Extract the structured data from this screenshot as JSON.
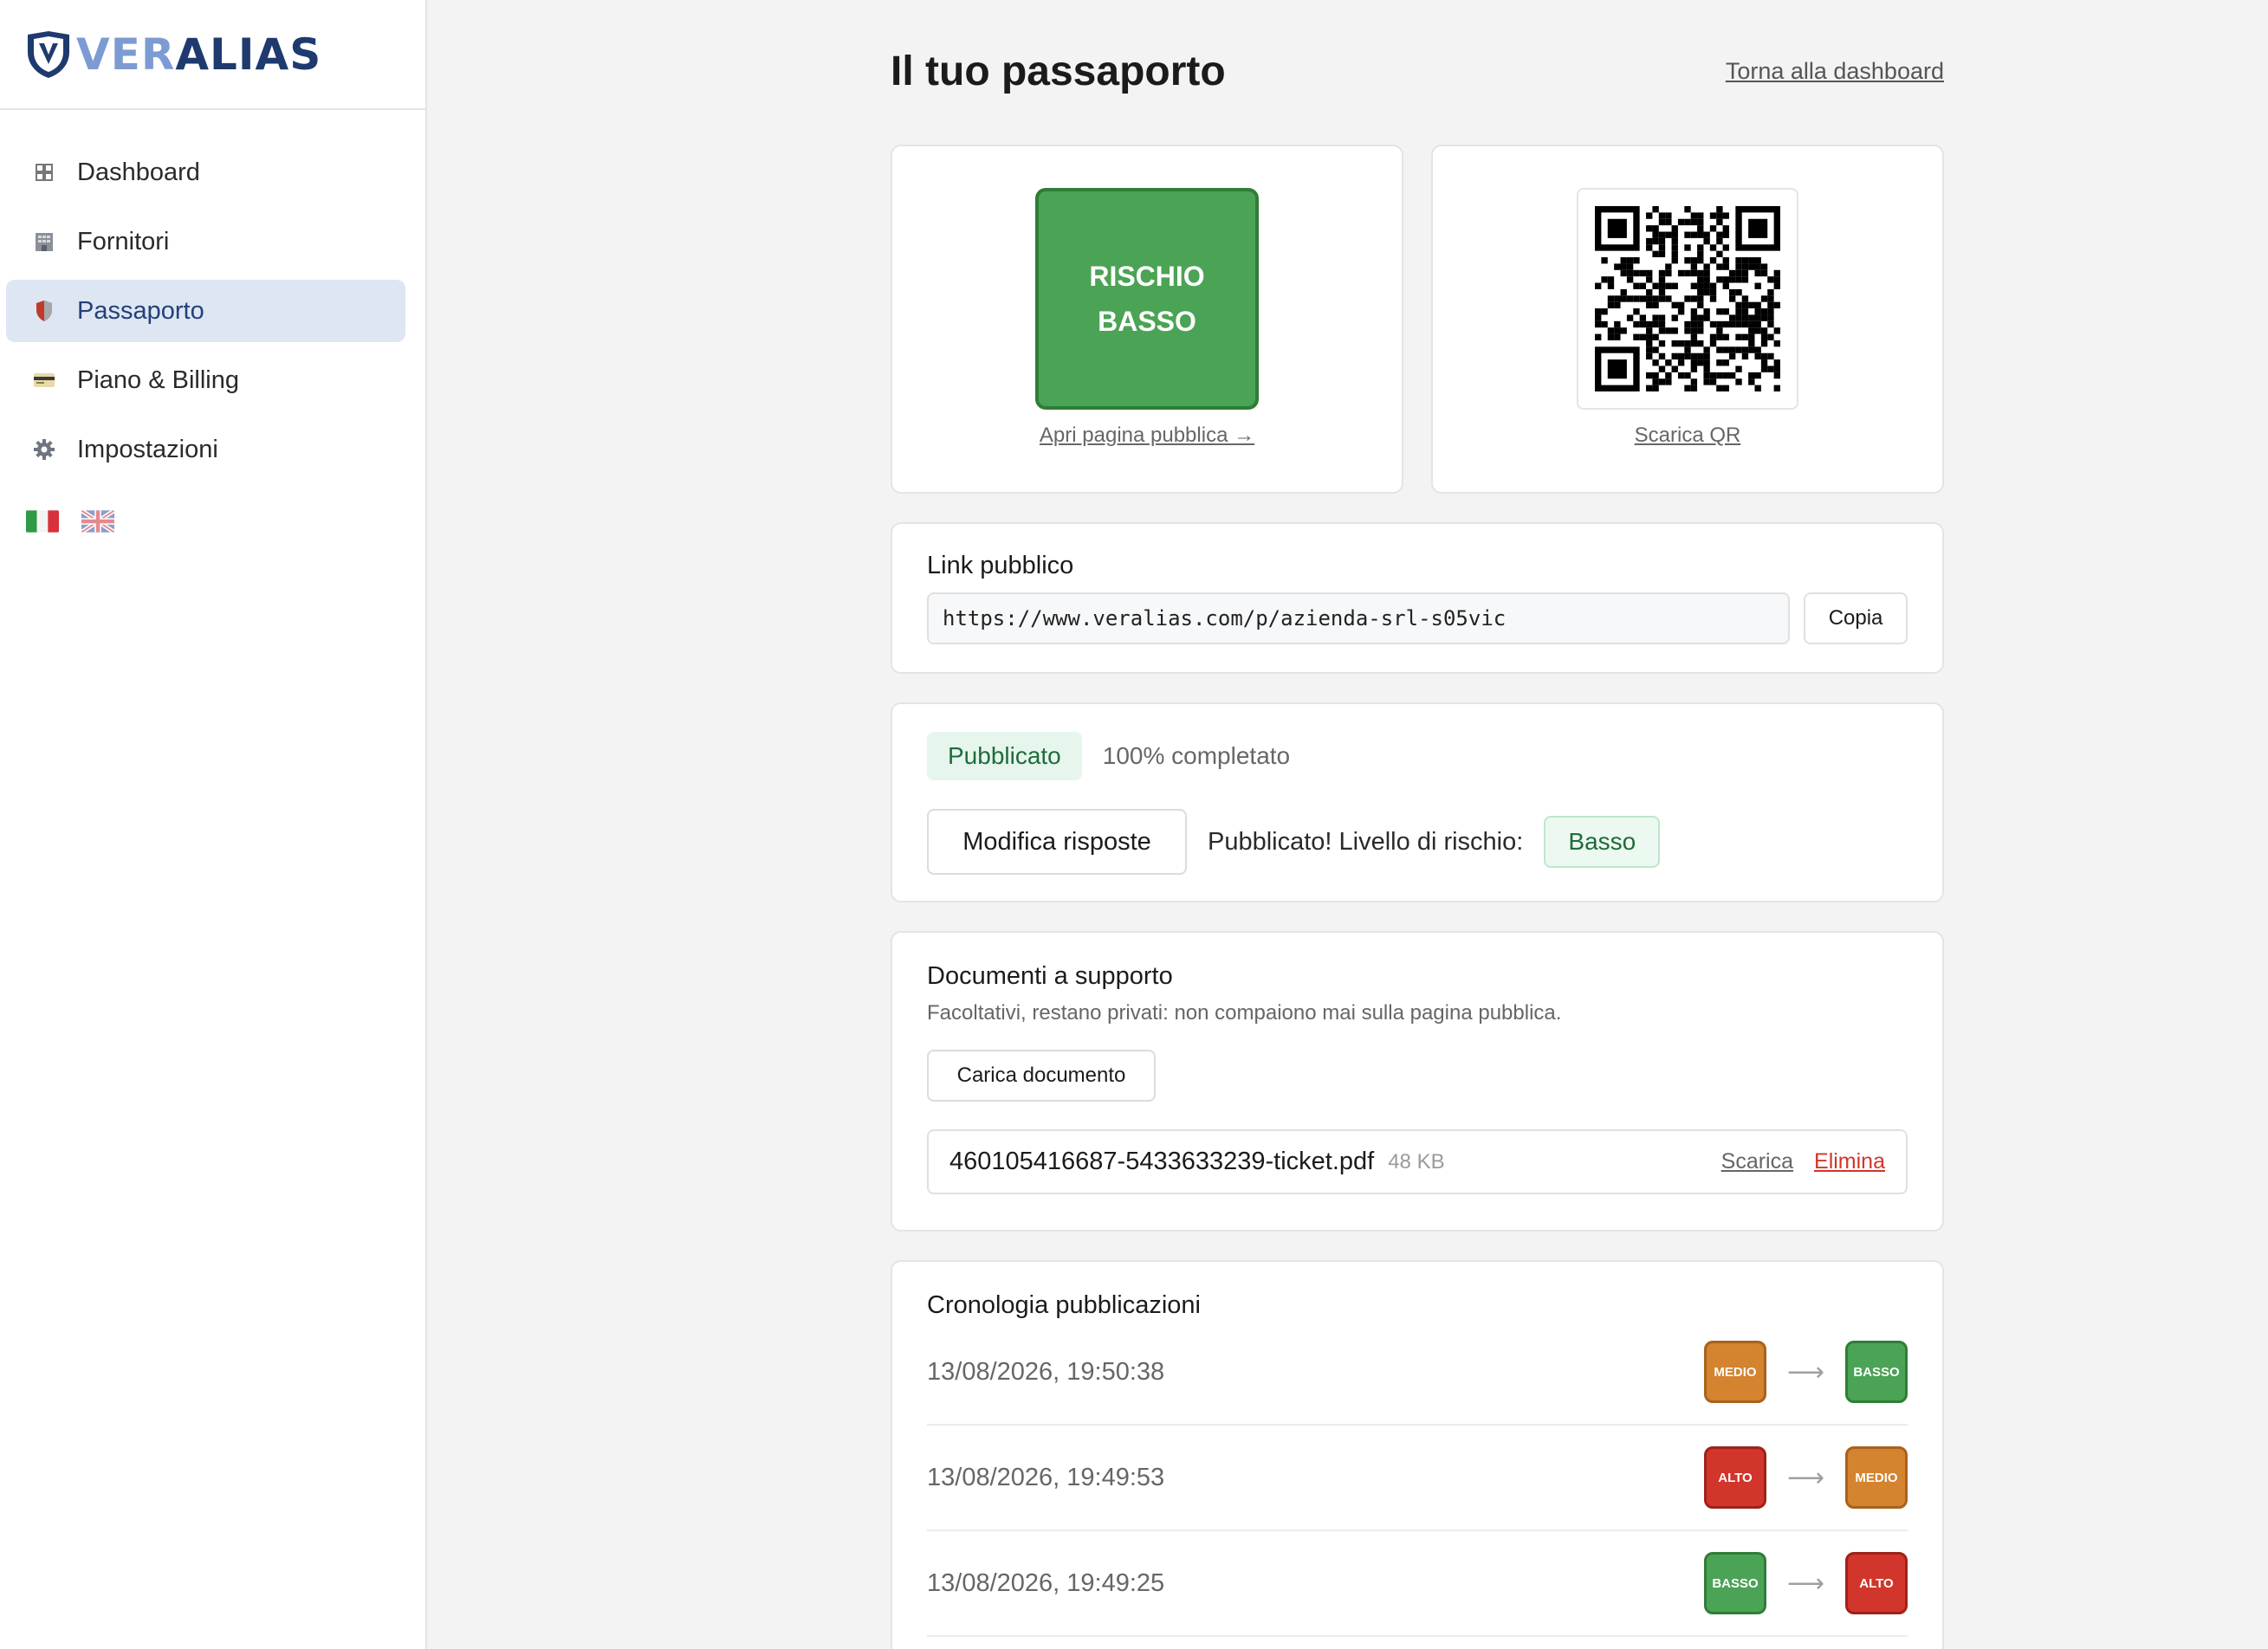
{
  "brand": {
    "part1": "VER",
    "part2": "ALIAS",
    "icon": "shield-logo"
  },
  "sidebar": {
    "items": [
      {
        "label": "Dashboard",
        "icon": "grid-icon",
        "active": false
      },
      {
        "label": "Fornitori",
        "icon": "building-icon",
        "active": false
      },
      {
        "label": "Passaporto",
        "icon": "shield-icon",
        "active": true
      },
      {
        "label": "Piano & Billing",
        "icon": "credit-card-icon",
        "active": false
      },
      {
        "label": "Impostazioni",
        "icon": "gear-icon",
        "active": false
      }
    ],
    "languages": [
      {
        "code": "it",
        "icon": "italy-flag-icon"
      },
      {
        "code": "en",
        "icon": "uk-flag-icon"
      }
    ]
  },
  "header": {
    "title": "Il tuo passaporto",
    "back_link": "Torna alla dashboard"
  },
  "risk_card": {
    "line1": "RISCHIO",
    "line2": "BASSO",
    "color": "#4ba355",
    "link": "Apri pagina pubblica →"
  },
  "qr_card": {
    "link": "Scarica QR",
    "icon": "qr-code"
  },
  "public_link": {
    "title": "Link pubblico",
    "url": "https://www.veralias.com/p/azienda-srl-s05vic",
    "copy_label": "Copia"
  },
  "status": {
    "badge": "Pubblicato",
    "progress_text": "100% completato",
    "progress": 100,
    "edit_label": "Modifica risposte",
    "published_text": "Pubblicato! Livello di rischio:",
    "level": "Basso"
  },
  "documents": {
    "title": "Documenti a supporto",
    "subtitle": "Facoltativi, restano privati: non compaiono mai sulla pagina pubblica.",
    "upload_label": "Carica documento",
    "files": [
      {
        "name": "460105416687-5433633239-ticket.pdf",
        "size": "48 KB",
        "download": "Scarica",
        "delete": "Elimina"
      }
    ]
  },
  "history": {
    "title": "Cronologia pubblicazioni",
    "rows": [
      {
        "date": "13/08/2026, 19:50:38",
        "from": "MEDIO",
        "to": "BASSO"
      },
      {
        "date": "13/08/2026, 19:49:53",
        "from": "ALTO",
        "to": "MEDIO"
      },
      {
        "date": "13/08/2026, 19:49:25",
        "from": "BASSO",
        "to": "ALTO"
      }
    ],
    "arrow": "⟶"
  },
  "colors": {
    "basso": "#4ba355",
    "medio": "#d4832f",
    "alto": "#d2352b",
    "accent": "#24407a"
  }
}
